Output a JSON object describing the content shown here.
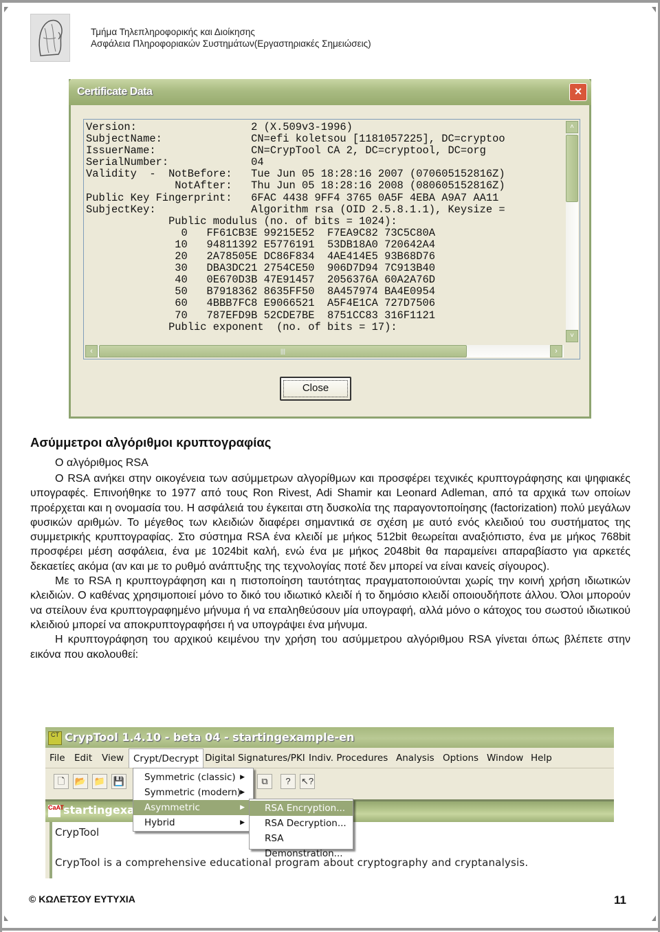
{
  "header": {
    "line1": "Τμήμα Τηλεπληροφορικής και Διοίκησης",
    "line2": "Ασφάλεια Πληροφοριακών Συστημάτων(Εργαστηριακές Σημειώσεις)",
    "logo_icon": "portrait-logo-icon"
  },
  "cert_dialog": {
    "title": "Certificate Data",
    "close_icon": "×",
    "lines": [
      "Version:                  2 (X.509v3-1996)",
      "SubjectName:              CN=efi koletsou [1181057225], DC=cryptoo",
      "IssuerName:               CN=CrypTool CA 2, DC=cryptool, DC=org",
      "SerialNumber:             04",
      "Validity  -  NotBefore:   Tue Jun 05 18:28:16 2007 (070605152816Z)",
      "              NotAfter:   Thu Jun 05 18:28:16 2008 (080605152816Z)",
      "Public Key Fingerprint:   6FAC 4438 9FF4 3765 0A5F 4EBA A9A7 AA11",
      "SubjectKey:               Algorithm rsa (OID 2.5.8.1.1), Keysize =",
      "             Public modulus (no. of bits = 1024):",
      "               0   FF61CB3E 99215E52  F7EA9C82 73C5C80A",
      "              10   94811392 E5776191  53DB18A0 720642A4",
      "              20   2A78505E DC86F834  4AE414E5 93B68D76",
      "              30   DBA3DC21 2754CE50  906D7D94 7C913B40",
      "              40   0E670D3B 47E91457  2056376A 60A2A76D",
      "              50   B7918362 8635FF50  8A457974 BA4E0954",
      "              60   4BBB7FC8 E9066521  A5F4E1CA 727D7506",
      "              70   787EFD9B 52CDE7BE  8751CC83 316F1121",
      "             Public exponent  (no. of bits = 17):"
    ],
    "close_button": "Close",
    "scroll_up": "˄",
    "scroll_down": "˅",
    "scroll_left": "‹",
    "scroll_right": "›"
  },
  "section": {
    "title": "Ασύμμετροι αλγόριθμοι κρυπτογραφίας",
    "subtitle": "Ο αλγόριθμος RSA",
    "paragraphs": [
      "Ο RSA ανήκει στην οικογένεια των ασύμμετρων αλγορίθμων και προσφέρει τεχνικές κρυπτογράφησης και ψηφιακές υπογραφές. Επινοήθηκε το 1977 από τους Ron Rivest, Adi Shamir και Leonard Adleman, από τα αρχικά των οποίων προέρχεται και η ονομασία του. Η ασφάλειά του έγκειται στη δυσκολία της παραγοντοποίησης (factorization) πολύ μεγάλων φυσικών αριθμών. Το μέγεθος των κλειδιών διαφέρει σημαντικά σε σχέση με αυτό ενός κλειδιού του συστήματος της συμμετρικής κρυπτογραφίας. Στο σύστημα RSA ένα κλειδί με μήκος 512bit θεωρείται αναξιόπιστο, ένα με μήκος 768bit προσφέρει μέση ασφάλεια, ένα με 1024bit καλή, ενώ ένα με μήκος 2048bit θα παραμείνει απαραβίαστο για αρκετές δεκαετίες ακόμα (αν και με το ρυθμό ανάπτυξης της τεχνολογίας ποτέ δεν μπορεί να είναι κανείς σίγουρος).",
      "Με το RSA η κρυπτογράφηση και η πιστοποίηση ταυτότητας πραγματοποιούνται χωρίς την κοινή χρήση ιδιωτικών κλειδιών. Ο καθένας χρησιμοποιεί μόνο το δικό του ιδιωτικό κλειδί ή το δημόσιο κλειδί οποιουδήποτε άλλου. Όλοι μπορούν να στείλουν ένα κρυπτογραφημένο μήνυμα ή να επαληθεύσουν μία υπογραφή, αλλά μόνο ο κάτοχος του σωστού ιδιωτικού κλειδιού μπορεί να αποκρυπτογραφήσει ή να υπογράψει ένα μήνυμα.",
      "Η κρυπτογράφηση του αρχικού κειμένου την χρήση του ασύμμετρου αλγόριθμου RSA γίνεται όπως βλέπετε στην εικόνα που ακολουθεί:"
    ]
  },
  "cryptool": {
    "title": "CrypTool 1.4.10 - beta 04 - startingexample-en",
    "app_icon": "CT",
    "menu": [
      "File",
      "Edit",
      "View",
      "Crypt/Decrypt",
      "Digital Signatures/PKI",
      "Indiv. Procedures",
      "Analysis",
      "Options",
      "Window",
      "Help"
    ],
    "open_menu": "Crypt/Decrypt",
    "toolbar": [
      "new-file",
      "open-folder",
      "open-recent",
      "save",
      "window-tile",
      "help",
      "context-help"
    ],
    "toolbar_glyphs": [
      "🗋",
      "📂",
      "📁",
      "💾",
      "⧉",
      "?",
      "↖?"
    ],
    "dropdown": [
      {
        "label": "Symmetric (classic)",
        "arrow": "▶",
        "highlighted": false
      },
      {
        "label": "Symmetric (modern)",
        "arrow": "▶",
        "highlighted": false
      },
      {
        "label": "Asymmetric",
        "arrow": "▶",
        "highlighted": true
      },
      {
        "label": "Hybrid",
        "arrow": "▶",
        "highlighted": false
      }
    ],
    "submenu": [
      {
        "label": "RSA Encryption...",
        "highlighted": true
      },
      {
        "label": "RSA Decryption...",
        "highlighted": false
      },
      {
        "label": "RSA Demonstration...",
        "highlighted": false
      }
    ],
    "doc_title": "startingexample-en",
    "doc_icon": "CaAT",
    "editor_line1": "CrypTool",
    "editor_line2": "CrypTool is a comprehensive educational program about cryptography and cryptanalysis."
  },
  "footer": {
    "author": "© ΚΩΛΕΤΣΟΥ ΕΥΤΥΧΙΑ",
    "page_number": "11"
  },
  "colors": {
    "xp_olive_title": "#a9bb82",
    "dialog_bg": "#ece9d8",
    "menu_highlight": "#98a876",
    "close_red": "#d9573a"
  }
}
